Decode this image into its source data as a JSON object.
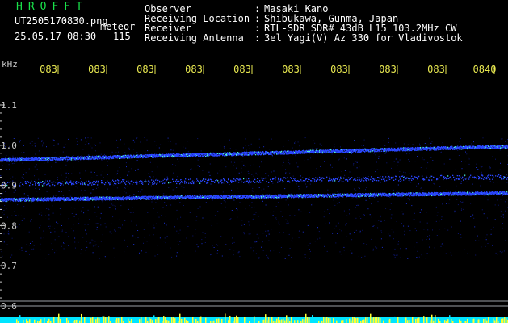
{
  "header": {
    "logo": "HROFFT",
    "filename": "UT2505170830.png",
    "meteor_label": "meteor",
    "datetime": "25.05.17 08:30",
    "meteor_count": "115",
    "info": [
      {
        "key": "Observer",
        "value": "Masaki Kano"
      },
      {
        "key": "Receiving Location",
        "value": "Shibukawa, Gunma, Japan"
      },
      {
        "key": "Receiver",
        "value": "RTL-SDR SDR# 43dB L15 103.2MHz CW"
      },
      {
        "key": "Receiving Antenna",
        "value": "3el Yagi(V) Az 330 for Vladivostok"
      }
    ]
  },
  "colors": {
    "background": "#000000",
    "logo": "#19e14a",
    "text": "#ffffff",
    "time_ticks": "#e8e850",
    "freq_axis": "#c8c8c8",
    "echo_trace": "#2a46ff",
    "echo_core": "#4cf2d2",
    "bottom_bar_cyan": "#00e5ff",
    "bottom_bar_yellow": "#ffff33"
  },
  "chart_data": {
    "type": "heatmap",
    "ylabel": "kHz",
    "yticks": [
      "1.1",
      "1.0",
      "0.9",
      "0.8",
      "0.7",
      "0.6"
    ],
    "ylim": [
      0.6,
      1.1
    ],
    "xticks": [
      "083",
      "083",
      "083",
      "083",
      "083",
      "083",
      "083",
      "083",
      "083",
      "0840"
    ],
    "xlim": [
      "08:30",
      "08:40"
    ],
    "traces": [
      {
        "start_khz": 0.964,
        "end_khz": 0.998
      },
      {
        "start_khz": 0.865,
        "end_khz": 0.882
      },
      {
        "start_khz": 0.905,
        "end_khz": 0.922
      }
    ],
    "reference_lines_khz": [
      0.612,
      0.6
    ]
  }
}
